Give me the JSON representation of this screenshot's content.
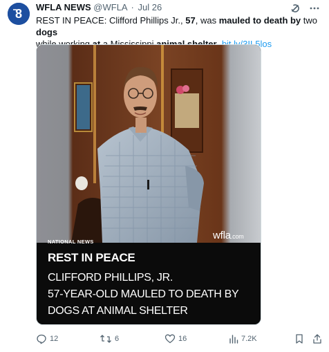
{
  "tweet": {
    "author_name": "WFLA NEWS",
    "handle": "@WFLA",
    "separator": "·",
    "date": "Jul 26",
    "text_parts": {
      "p1": "REST IN PEACE: Clifford Phillips Jr., ",
      "p2": "57",
      "p3": ", was ",
      "p4": "mauled to death by",
      "p5": " two ",
      "p6": "dogs",
      "p7": " while working ",
      "p8": "at",
      "p9": " a Mississippi ",
      "p10": "animal shelter",
      "p11": ". ",
      "link": "bit.ly/3IL5los"
    }
  },
  "card": {
    "watermark": "wfla",
    "watermark_suffix": ".com",
    "tag": "NATIONAL NEWS",
    "title": "REST IN PEACE",
    "line1": "CLIFFORD PHILLIPS, JR.",
    "line2": "57-YEAR-OLD MAULED TO DEATH BY",
    "line3": "DOGS AT ANIMAL SHELTER"
  },
  "actions": {
    "replies": "12",
    "retweets": "6",
    "likes": "16",
    "views": "7.2K"
  },
  "icons": {
    "avatar": "wfla-8-logo",
    "grok": "grok-icon",
    "more": "more-icon",
    "reply": "reply-icon",
    "retweet": "retweet-icon",
    "like": "heart-icon",
    "views": "views-icon",
    "bookmark": "bookmark-icon",
    "share": "share-icon"
  },
  "colors": {
    "link": "#1d9bf0",
    "avatar_bg": "#1d4fa0",
    "muted": "#536471"
  }
}
